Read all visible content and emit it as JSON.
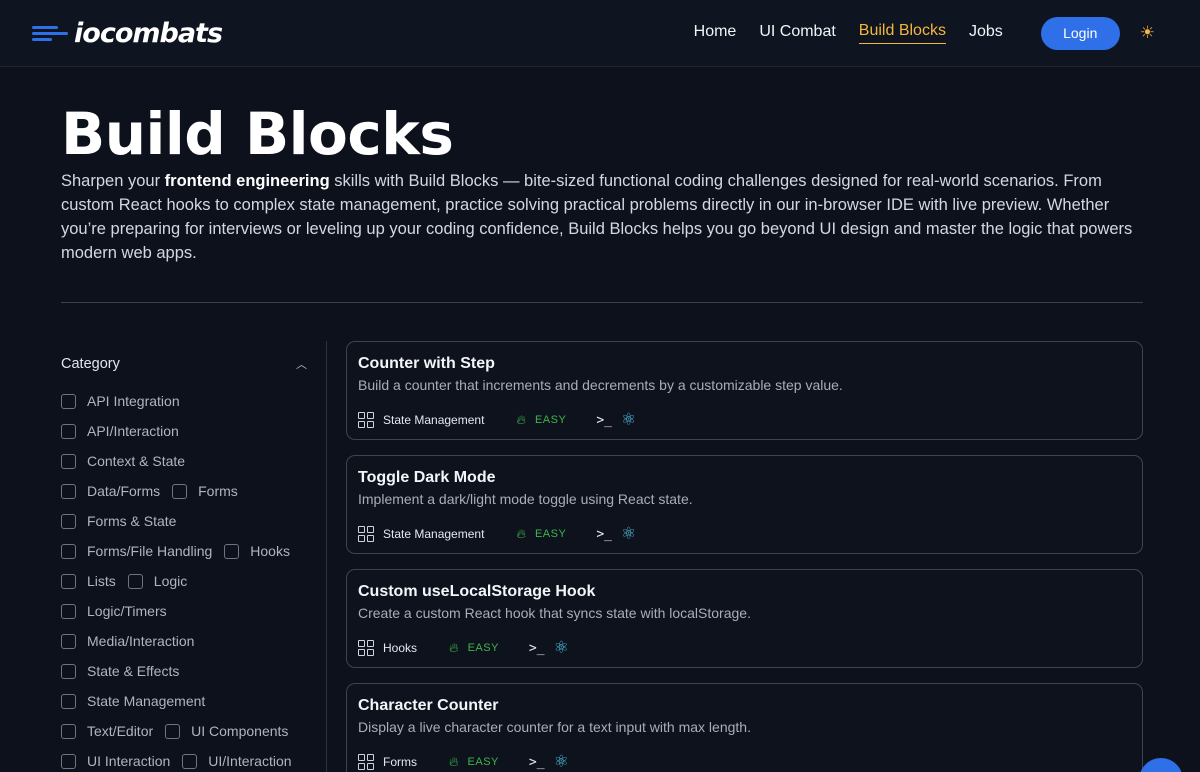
{
  "header": {
    "logo_io": "io",
    "logo_rest": "combats",
    "nav": [
      "Home",
      "UI Combat",
      "Build Blocks",
      "Jobs"
    ],
    "login_label": "Login",
    "theme_icon": "☀"
  },
  "hero": {
    "title": "Build Blocks",
    "intro_before": "Sharpen your ",
    "intro_bold": "frontend engineering",
    "intro_after": " skills with Build Blocks — bite-sized functional coding challenges designed for real-world scenarios. From custom React hooks to complex state management, practice solving practical problems directly in our in-browser IDE with live preview. Whether you’re preparing for interviews or leveling up your coding confidence, Build Blocks helps you go beyond UI design and master the logic that powers modern web apps."
  },
  "sidebar": {
    "heading": "Category",
    "rows": [
      [
        "API Integration"
      ],
      [
        "API/Interaction"
      ],
      [
        "Context & State"
      ],
      [
        "Data/Forms",
        "Forms"
      ],
      [
        "Forms & State"
      ],
      [
        "Forms/File Handling",
        "Hooks"
      ],
      [
        "Lists",
        "Logic"
      ],
      [
        "Logic/Timers"
      ],
      [
        "Media/Interaction"
      ],
      [
        "State & Effects"
      ],
      [
        "State Management"
      ],
      [
        "Text/Editor",
        "UI Components"
      ],
      [
        "UI Interaction",
        "UI/Interaction"
      ]
    ]
  },
  "cards": [
    {
      "title": "Counter with Step",
      "desc": "Build a counter that increments and decrements by a customizable step value.",
      "category": "State Management",
      "difficulty": "EASY"
    },
    {
      "title": "Toggle Dark Mode",
      "desc": "Implement a dark/light mode toggle using React state.",
      "category": "State Management",
      "difficulty": "EASY"
    },
    {
      "title": "Custom useLocalStorage Hook",
      "desc": "Create a custom React hook that syncs state with localStorage.",
      "category": "Hooks",
      "difficulty": "EASY"
    },
    {
      "title": "Character Counter",
      "desc": "Display a live character counter for a text input with max length.",
      "category": "Forms",
      "difficulty": "EASY"
    }
  ],
  "icons": {
    "terminal": ">_",
    "react": "⚛",
    "flame": "🔥︎"
  },
  "colors": {
    "accent": "#2f6fe8",
    "active_nav": "#f4b63f",
    "easy": "#3fb54a"
  }
}
